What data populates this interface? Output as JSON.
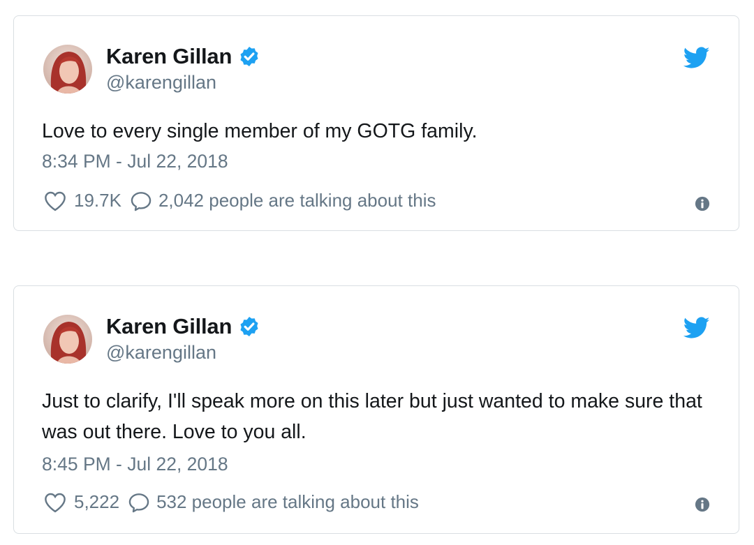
{
  "tweets": [
    {
      "author_name": "Karen Gillan",
      "handle": "@karengillan",
      "text": "Love to every single member of my GOTG family.",
      "timestamp": "8:34 PM - Jul 22, 2018",
      "likes": "19.7K",
      "talking": "2,042 people are talking about this"
    },
    {
      "author_name": "Karen Gillan",
      "handle": "@karengillan",
      "text": "Just to clarify, I'll speak more on this later but just wanted to make sure that was out there. Love to you all.",
      "timestamp": "8:45 PM - Jul 22, 2018",
      "likes": "5,222",
      "talking": "532 people are talking about this"
    }
  ],
  "icons": {
    "verified": "verified-badge-icon",
    "brand": "twitter-bird-icon",
    "like": "heart-icon",
    "reply": "speech-bubble-icon",
    "info": "info-icon"
  },
  "colors": {
    "brand_blue": "#1da1f2",
    "text_primary": "#14171a",
    "text_secondary": "#657786",
    "border": "#d9dee2"
  }
}
